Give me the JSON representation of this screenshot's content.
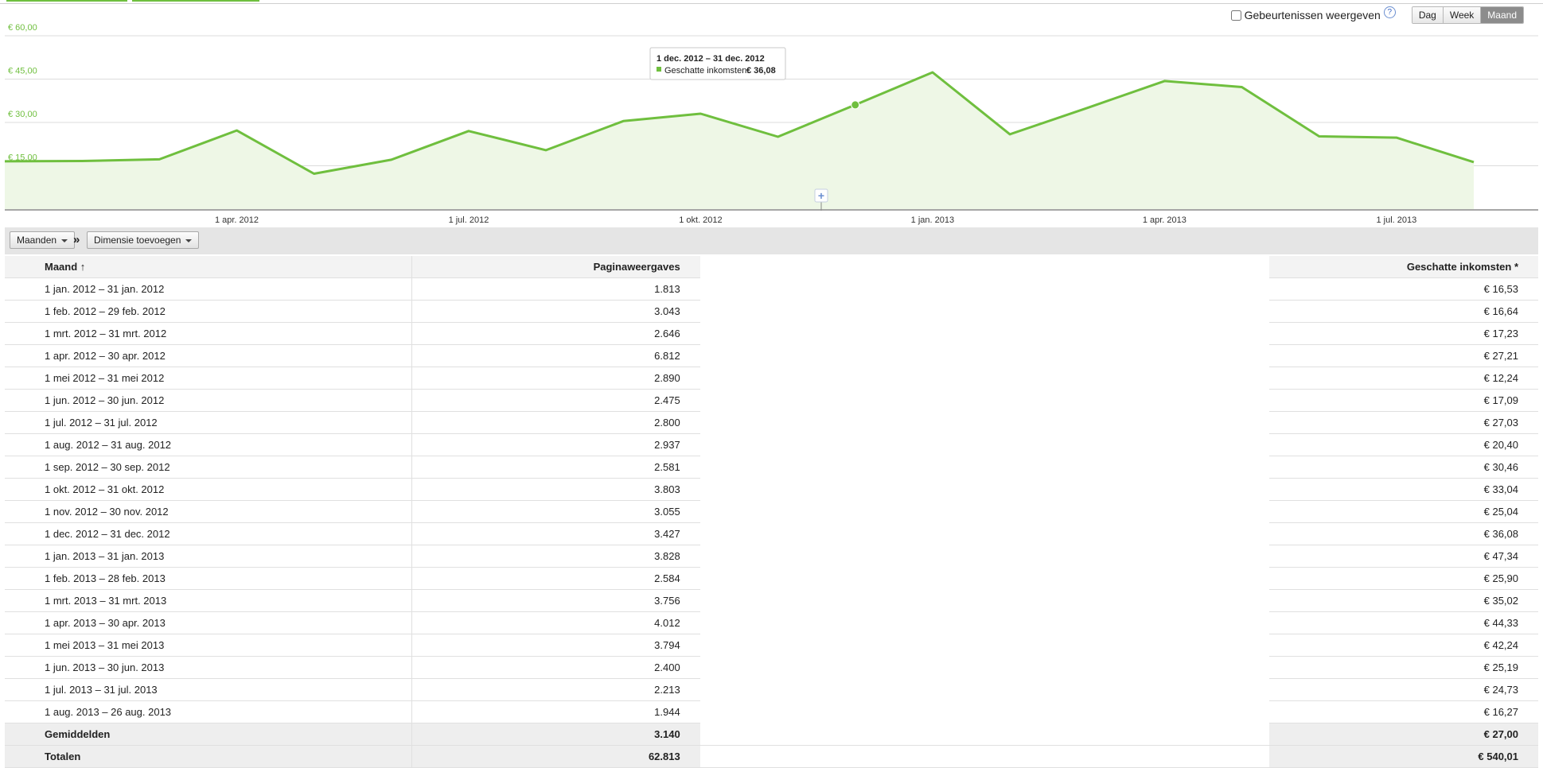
{
  "controls": {
    "show_events_label": "Gebeurtenissen weergeven",
    "help": "?",
    "day": "Dag",
    "week": "Week",
    "month": "Maand"
  },
  "chart_data": {
    "type": "area",
    "x": [
      "2012-01",
      "2012-02",
      "2012-03",
      "2012-04",
      "2012-05",
      "2012-06",
      "2012-07",
      "2012-08",
      "2012-09",
      "2012-10",
      "2012-11",
      "2012-12",
      "2013-01",
      "2013-02",
      "2013-03",
      "2013-04",
      "2013-05",
      "2013-06",
      "2013-07",
      "2013-08"
    ],
    "series": [
      {
        "name": "Geschatte inkomsten",
        "values": [
          16.53,
          16.64,
          17.23,
          27.21,
          12.24,
          17.09,
          27.03,
          20.4,
          30.46,
          33.04,
          25.04,
          36.08,
          47.34,
          25.9,
          35.02,
          44.33,
          42.24,
          25.19,
          24.73,
          16.27
        ]
      }
    ],
    "y_ticks": [
      "€ 60,00",
      "€ 45,00",
      "€ 30,00",
      "€ 15,00"
    ],
    "x_ticks": [
      "1 apr. 2012",
      "1 jul. 2012",
      "1 okt. 2012",
      "1 jan. 2013",
      "1 apr. 2013",
      "1 jul. 2013"
    ],
    "ylim": [
      0,
      60
    ],
    "grid": true,
    "color": "#6fbf3e",
    "fill": "#eef7e6",
    "highlight_index": 11,
    "tooltip": {
      "title": "1 dec. 2012 – 31 dec. 2012",
      "label": "Geschatte inkomsten:",
      "value": "€ 36,08"
    },
    "annotation_button": "+"
  },
  "toolbar": {
    "dimension": "Maanden",
    "separator": "»",
    "add_dimension": "Dimensie toevoegen"
  },
  "table": {
    "headers": {
      "month": "Maand",
      "sort": "↑",
      "pageviews": "Paginaweergaves",
      "revenue": "Geschatte inkomsten *"
    },
    "rows": [
      {
        "month": "1 jan. 2012 – 31 jan. 2012",
        "pageviews": "1.813",
        "revenue": "€ 16,53"
      },
      {
        "month": "1 feb. 2012 – 29 feb. 2012",
        "pageviews": "3.043",
        "revenue": "€ 16,64"
      },
      {
        "month": "1 mrt. 2012 – 31 mrt. 2012",
        "pageviews": "2.646",
        "revenue": "€ 17,23"
      },
      {
        "month": "1 apr. 2012 – 30 apr. 2012",
        "pageviews": "6.812",
        "revenue": "€ 27,21"
      },
      {
        "month": "1 mei 2012 – 31 mei 2012",
        "pageviews": "2.890",
        "revenue": "€ 12,24"
      },
      {
        "month": "1 jun. 2012 – 30 jun. 2012",
        "pageviews": "2.475",
        "revenue": "€ 17,09"
      },
      {
        "month": "1 jul. 2012 – 31 jul. 2012",
        "pageviews": "2.800",
        "revenue": "€ 27,03"
      },
      {
        "month": "1 aug. 2012 – 31 aug. 2012",
        "pageviews": "2.937",
        "revenue": "€ 20,40"
      },
      {
        "month": "1 sep. 2012 – 30 sep. 2012",
        "pageviews": "2.581",
        "revenue": "€ 30,46"
      },
      {
        "month": "1 okt. 2012 – 31 okt. 2012",
        "pageviews": "3.803",
        "revenue": "€ 33,04"
      },
      {
        "month": "1 nov. 2012 – 30 nov. 2012",
        "pageviews": "3.055",
        "revenue": "€ 25,04"
      },
      {
        "month": "1 dec. 2012 – 31 dec. 2012",
        "pageviews": "3.427",
        "revenue": "€ 36,08"
      },
      {
        "month": "1 jan. 2013 – 31 jan. 2013",
        "pageviews": "3.828",
        "revenue": "€ 47,34"
      },
      {
        "month": "1 feb. 2013 – 28 feb. 2013",
        "pageviews": "2.584",
        "revenue": "€ 25,90"
      },
      {
        "month": "1 mrt. 2013 – 31 mrt. 2013",
        "pageviews": "3.756",
        "revenue": "€ 35,02"
      },
      {
        "month": "1 apr. 2013 – 30 apr. 2013",
        "pageviews": "4.012",
        "revenue": "€ 44,33"
      },
      {
        "month": "1 mei 2013 – 31 mei 2013",
        "pageviews": "3.794",
        "revenue": "€ 42,24"
      },
      {
        "month": "1 jun. 2013 – 30 jun. 2013",
        "pageviews": "2.400",
        "revenue": "€ 25,19"
      },
      {
        "month": "1 jul. 2013 – 31 jul. 2013",
        "pageviews": "2.213",
        "revenue": "€ 24,73"
      },
      {
        "month": "1 aug. 2013 – 26 aug. 2013",
        "pageviews": "1.944",
        "revenue": "€ 16,27"
      }
    ],
    "averages": {
      "label": "Gemiddelden",
      "pageviews": "3.140",
      "revenue": "€ 27,00"
    },
    "totals": {
      "label": "Totalen",
      "pageviews": "62.813",
      "revenue": "€ 540,01"
    }
  }
}
